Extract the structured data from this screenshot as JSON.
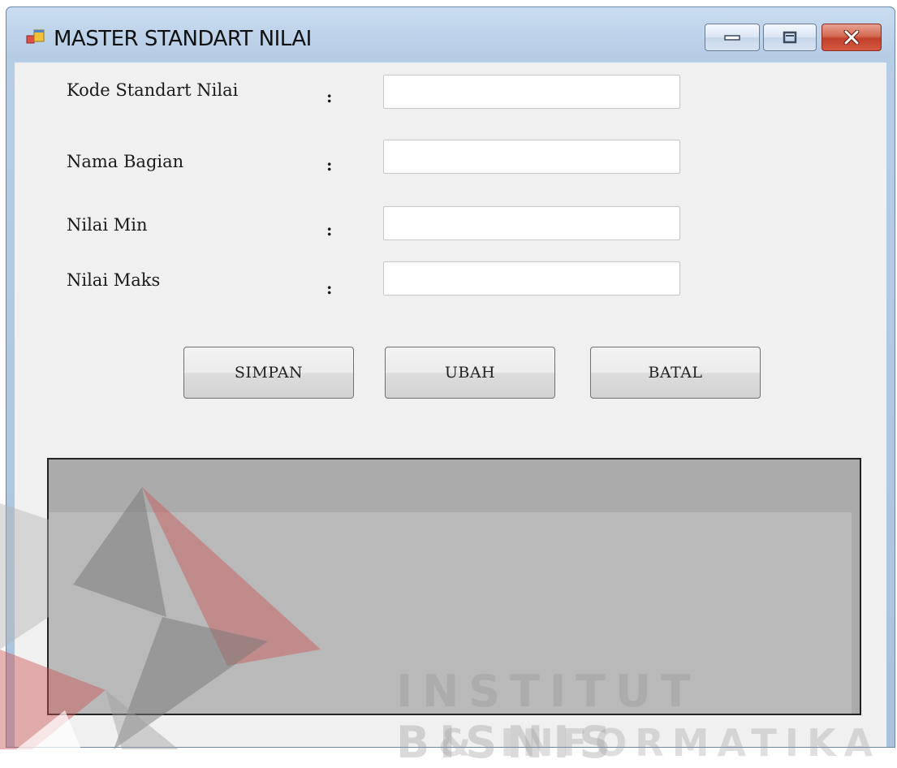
{
  "window": {
    "title": "MASTER STANDART NILAI"
  },
  "form": {
    "fields": [
      {
        "label": "Kode Standart Nilai",
        "colon": ":",
        "value": ""
      },
      {
        "label": "Nama Bagian",
        "colon": ":",
        "value": ""
      },
      {
        "label": "Nilai Min",
        "colon": ":",
        "value": ""
      },
      {
        "label": "Nilai Maks",
        "colon": ":",
        "value": ""
      }
    ]
  },
  "buttons": {
    "save": "SIMPAN",
    "edit": "UBAH",
    "cancel": "BATAL"
  },
  "watermark": {
    "line1": "INSTITUT BISNIS",
    "line2": "& INFORMATIKA"
  }
}
